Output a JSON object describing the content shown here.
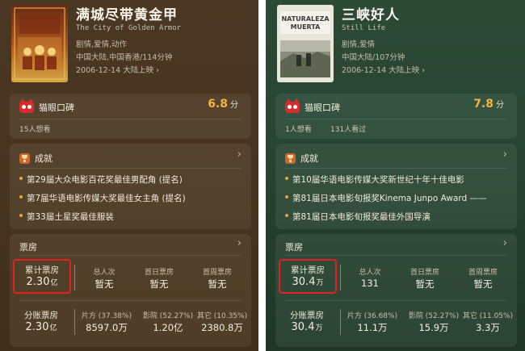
{
  "movies": [
    {
      "title": "满城尽带黄金甲",
      "en_title": "The City of Golden Armor",
      "genres": "剧情,爱情,动作",
      "region_runtime": "中国大陆,中国香港/114分钟",
      "release": "2006-12-14 大陆上映",
      "release_chevron": "›",
      "poster_text": "满城尽带黄金甲",
      "maoyan_label": "猫眼口碑",
      "score": "6.8",
      "score_unit": "分",
      "want_text": "15人想看",
      "watched_text": "",
      "achievements_title": "成就",
      "achievements": [
        "第29届大众电影百花奖最佳男配角 (提名)",
        "第7届华语电影传媒大奖最佳女主角 (提名)",
        "第33届土星奖最佳服装"
      ],
      "box_office": {
        "title": "票房",
        "total_label": "累计票房",
        "total_value": "2.30",
        "total_unit": "亿",
        "admissions_label": "总人次",
        "admissions_value": "暂无",
        "first_day_label": "首日票房",
        "first_day_value": "暂无",
        "first_week_label": "首周票房",
        "first_week_value": "暂无",
        "split_label": "分账票房",
        "split_value": "2.30",
        "split_unit": "亿",
        "film_label": "片方 (37.38%)",
        "film_value": "8597.0万",
        "cinema_label": "影院 (52.27%)",
        "cinema_value": "1.20亿",
        "other_label": "其它 (10.35%)",
        "other_value": "2380.8万"
      }
    },
    {
      "title": "三峡好人",
      "en_title": "Still Life",
      "genres": "剧情,爱情",
      "region_runtime": "中国大陆/107分钟",
      "release": "2006-12-14 大陆上映",
      "release_chevron": "›",
      "poster_text": "NATURALEZA MUERTA",
      "maoyan_label": "猫眼口碑",
      "score": "7.8",
      "score_unit": "分",
      "want_text": "1人想看",
      "watched_text": "131人看过",
      "achievements_title": "成就",
      "achievements": [
        "第10届华语电影传媒大奖新世纪十年十佳电影",
        "第81届日本电影旬报奖Kinema Junpo Award ——",
        "第81届日本电影旬报奖最佳外国导演"
      ],
      "box_office": {
        "title": "票房",
        "total_label": "累计票房",
        "total_value": "30.4",
        "total_unit": "万",
        "admissions_label": "总人次",
        "admissions_value": "131",
        "first_day_label": "首日票房",
        "first_day_value": "暂无",
        "first_week_label": "首周票房",
        "first_week_value": "暂无",
        "split_label": "分账票房",
        "split_value": "30.4",
        "split_unit": "万",
        "film_label": "片方 (36.68%)",
        "film_value": "11.1万",
        "cinema_label": "影院 (52.27%)",
        "cinema_value": "15.9万",
        "other_label": "其它 (11.05%)",
        "other_value": "3.3万"
      }
    }
  ],
  "icons": {
    "maoyan": "maoyan-cat-logo-icon",
    "achievement": "trophy-icon",
    "chevron": "chevron-right-icon"
  },
  "colors": {
    "left_bg": "#473521",
    "right_bg": "#284331",
    "score": "#f4b43a",
    "highlight": "#e41f1f"
  }
}
